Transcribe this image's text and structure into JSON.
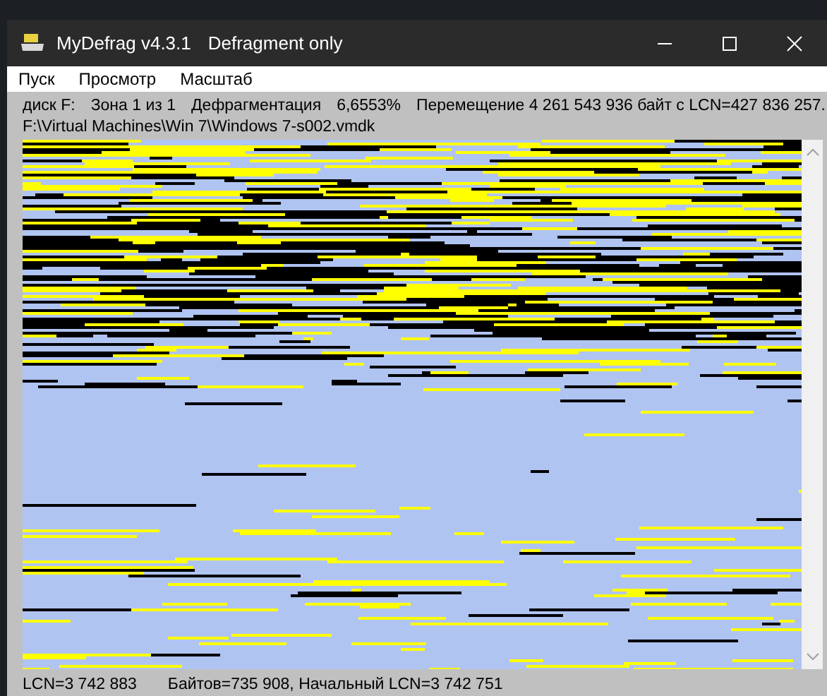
{
  "window": {
    "title": "MyDefrag v4.3.1",
    "subtitle": "Defragment only"
  },
  "menu": [
    {
      "label": "Пуск"
    },
    {
      "label": "Просмотр"
    },
    {
      "label": "Масштаб"
    }
  ],
  "status": {
    "parts": [
      "диск F:",
      "Зона 1 из 1",
      "Дефрагментация",
      "6,6553%",
      "Перемещение 4 261 543 936 байт с LCN=427 836 257."
    ],
    "path": "F:\\Virtual Machines\\Win 7\\Windows 7-s002.vmdk"
  },
  "footer": {
    "parts": [
      "LCN=3 742 883",
      "Байтов=735 908, Начальный LCN=3 742 751"
    ]
  }
}
